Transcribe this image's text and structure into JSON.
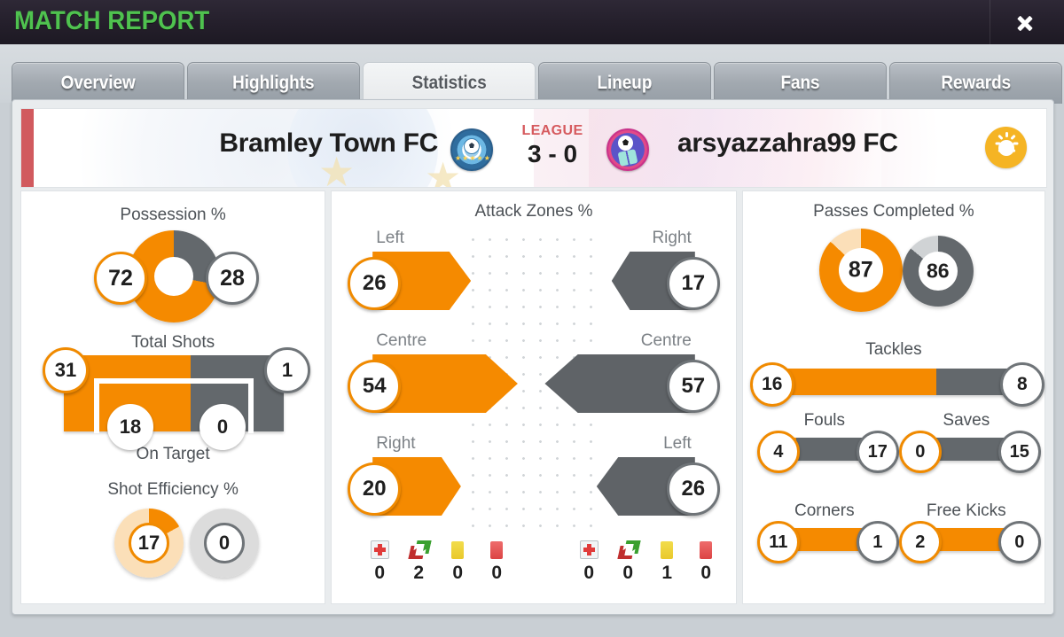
{
  "window": {
    "title": "MATCH REPORT",
    "close_label": "close-icon"
  },
  "tabs": [
    {
      "label": "Overview",
      "active": false
    },
    {
      "label": "Highlights",
      "active": false
    },
    {
      "label": "Statistics",
      "active": true
    },
    {
      "label": "Lineup",
      "active": false
    },
    {
      "label": "Fans",
      "active": false
    },
    {
      "label": "Rewards",
      "active": false
    }
  ],
  "scoreline": {
    "home_team": "Bramley Town FC",
    "away_team": "arsyazzahra99 FC",
    "competition": "LEAGUE",
    "score": "3 - 0",
    "weather_icon": "sun-icon"
  },
  "colors": {
    "home": "#f58a00",
    "away": "#63686c",
    "home_light": "#fbdfb8",
    "away_light": "#d0d3d5",
    "accent_green": "#4fc24f",
    "league_red": "#d65a5e"
  },
  "chart_data": [
    {
      "type": "pie",
      "title": "Possession %",
      "categories": [
        "Bramley Town FC",
        "arsyazzahra99 FC"
      ],
      "values": [
        72,
        28
      ]
    },
    {
      "type": "bar",
      "title": "Total Shots",
      "categories": [
        "Bramley Town FC",
        "arsyazzahra99 FC"
      ],
      "values": [
        31,
        1
      ]
    },
    {
      "type": "bar",
      "title": "On Target",
      "categories": [
        "Bramley Town FC",
        "arsyazzahra99 FC"
      ],
      "values": [
        18,
        0
      ]
    },
    {
      "type": "pie",
      "title": "Shot Efficiency %",
      "categories": [
        "Bramley Town FC",
        "arsyazzahra99 FC"
      ],
      "values": [
        17,
        0
      ]
    },
    {
      "type": "bar",
      "title": "Attack Zones %",
      "categories": [
        "Left",
        "Centre",
        "Right"
      ],
      "series": [
        {
          "name": "Bramley Town FC",
          "values": [
            26,
            54,
            20
          ]
        },
        {
          "name": "arsyazzahra99 FC",
          "values": [
            17,
            57,
            26
          ]
        }
      ]
    },
    {
      "type": "pie",
      "title": "Passes Completed %",
      "categories": [
        "Bramley Town FC",
        "arsyazzahra99 FC"
      ],
      "values": [
        87,
        86
      ]
    },
    {
      "type": "bar",
      "title": "Tackles",
      "categories": [
        "Bramley Town FC",
        "arsyazzahra99 FC"
      ],
      "values": [
        16,
        8
      ]
    },
    {
      "type": "bar",
      "title": "Fouls",
      "categories": [
        "Bramley Town FC",
        "arsyazzahra99 FC"
      ],
      "values": [
        4,
        17
      ]
    },
    {
      "type": "bar",
      "title": "Saves",
      "categories": [
        "Bramley Town FC",
        "arsyazzahra99 FC"
      ],
      "values": [
        0,
        15
      ]
    },
    {
      "type": "bar",
      "title": "Corners",
      "categories": [
        "Bramley Town FC",
        "arsyazzahra99 FC"
      ],
      "values": [
        11,
        1
      ]
    },
    {
      "type": "bar",
      "title": "Free Kicks",
      "categories": [
        "Bramley Town FC",
        "arsyazzahra99 FC"
      ],
      "values": [
        2,
        0
      ]
    }
  ],
  "stats": {
    "possession": {
      "title": "Possession %",
      "home": "72",
      "away": "28"
    },
    "total_shots": {
      "title": "Total Shots",
      "home": "31",
      "away": "1"
    },
    "on_target": {
      "title": "On Target",
      "home": "18",
      "away": "0"
    },
    "shot_efficiency": {
      "title": "Shot Efficiency %",
      "home": "17",
      "away": "0"
    },
    "attack_zones": {
      "title": "Attack Zones %",
      "rows": [
        {
          "home_label": "Left",
          "home": "26",
          "away_label": "Right",
          "away": "17"
        },
        {
          "home_label": "Centre",
          "home": "54",
          "away_label": "Centre",
          "away": "57"
        },
        {
          "home_label": "Right",
          "home": "20",
          "away_label": "Left",
          "away": "26"
        }
      ]
    },
    "passes_completed": {
      "title": "Passes Completed %",
      "home": "87",
      "away": "86"
    },
    "tackles": {
      "title": "Tackles",
      "home": "16",
      "away": "8"
    },
    "fouls": {
      "title": "Fouls",
      "home": "4",
      "away": "17"
    },
    "saves": {
      "title": "Saves",
      "home": "0",
      "away": "15"
    },
    "corners": {
      "title": "Corners",
      "home": "11",
      "away": "1"
    },
    "free_kicks": {
      "title": "Free Kicks",
      "home": "2",
      "away": "0"
    }
  },
  "events": {
    "home": [
      {
        "icon": "injury-icon",
        "count": "0"
      },
      {
        "icon": "substitution-icon",
        "count": "2"
      },
      {
        "icon": "yellow-card-icon",
        "count": "0"
      },
      {
        "icon": "red-card-icon",
        "count": "0"
      }
    ],
    "away": [
      {
        "icon": "injury-icon",
        "count": "0"
      },
      {
        "icon": "substitution-icon",
        "count": "0"
      },
      {
        "icon": "yellow-card-icon",
        "count": "1"
      },
      {
        "icon": "red-card-icon",
        "count": "0"
      }
    ]
  }
}
